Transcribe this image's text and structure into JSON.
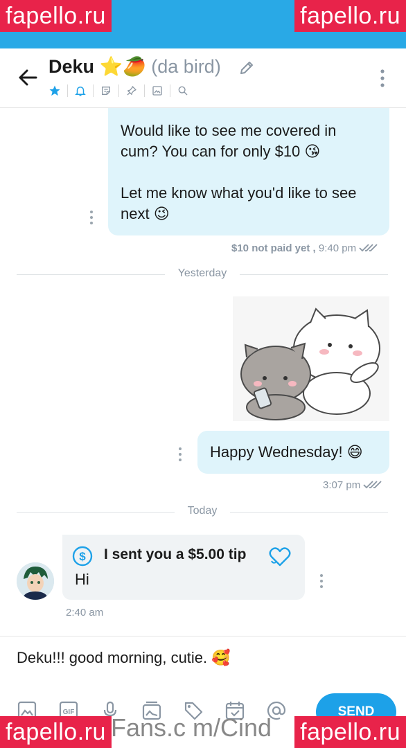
{
  "colors": {
    "accent": "#29a9e6",
    "send": "#1da1e8",
    "outgoing_bubble": "#dff4fb",
    "incoming_bubble": "#f0f3f5",
    "watermark": "#e8234a"
  },
  "watermarks": {
    "text": "fapello.ru",
    "bottom_url_fragment": "Fans.c m/Cind"
  },
  "header": {
    "name": "Deku ⭐🥭",
    "subtitle": "(da bird)",
    "icons": [
      "back-arrow-icon",
      "pencil-icon",
      "more-vertical-icon",
      "star-icon",
      "bell-icon",
      "note-icon",
      "pin-icon",
      "image-icon",
      "search-icon"
    ]
  },
  "messages": [
    {
      "line1": "Would like to see me covered in cum? You can for only $10 😘",
      "line2": "Let me know what you'd like to see next 😉",
      "price_status": "$10 not paid yet ,",
      "time": "9:40 pm"
    },
    {
      "divider": "Yesterday"
    },
    {
      "text": "Happy Wednesday! 😄",
      "time": "3:07 pm"
    },
    {
      "divider": "Today"
    },
    {
      "tip_label": "I sent you a $5.00 tip",
      "text": "Hi",
      "time": "2:40 am"
    }
  ],
  "composer": {
    "draft": "Deku!!! good morning, cutie. 🥰",
    "send_label": "SEND",
    "tools": [
      "image-icon",
      "gif-icon",
      "microphone-icon",
      "media-vault-icon",
      "price-tag-icon",
      "schedule-icon",
      "mention-icon"
    ]
  }
}
